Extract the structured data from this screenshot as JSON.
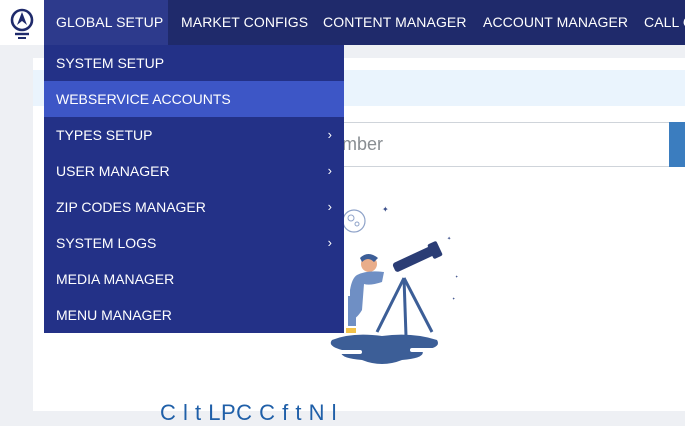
{
  "nav": {
    "items": [
      {
        "label": "GLOBAL SETUP",
        "active": true
      },
      {
        "label": "MARKET CONFIGS",
        "active": false
      },
      {
        "label": "CONTENT MANAGER",
        "active": false
      },
      {
        "label": "ACCOUNT MANAGER",
        "active": false
      },
      {
        "label": "CALL C",
        "active": false
      }
    ]
  },
  "dropdown": {
    "items": [
      {
        "label": "SYSTEM SETUP",
        "submenu": false
      },
      {
        "label": "WEBSERVICE ACCOUNTS",
        "submenu": false,
        "highlighted": true
      },
      {
        "label": "TYPES SETUP",
        "submenu": true
      },
      {
        "label": "USER MANAGER",
        "submenu": true
      },
      {
        "label": "ZIP CODES MANAGER",
        "submenu": true
      },
      {
        "label": "SYSTEM LOGS",
        "submenu": true
      },
      {
        "label": "MEDIA MANAGER",
        "submenu": false
      },
      {
        "label": "MENU MANAGER",
        "submenu": false
      }
    ],
    "chevron_glyph": "›"
  },
  "search": {
    "visible_text": "mber"
  },
  "content": {
    "partial_heading": "C    l  t  LPC    C    f     t   N   l"
  },
  "colors": {
    "nav_bg": "#1f2a6b",
    "dropdown_bg": "#233187",
    "highlight_bg": "#3d56c6",
    "accent": "#3b7dbf"
  },
  "icons": {
    "logo": "brand-logo-icon",
    "chevron": "chevron-right-icon",
    "illustration": "astronomer-telescope-illustration"
  }
}
